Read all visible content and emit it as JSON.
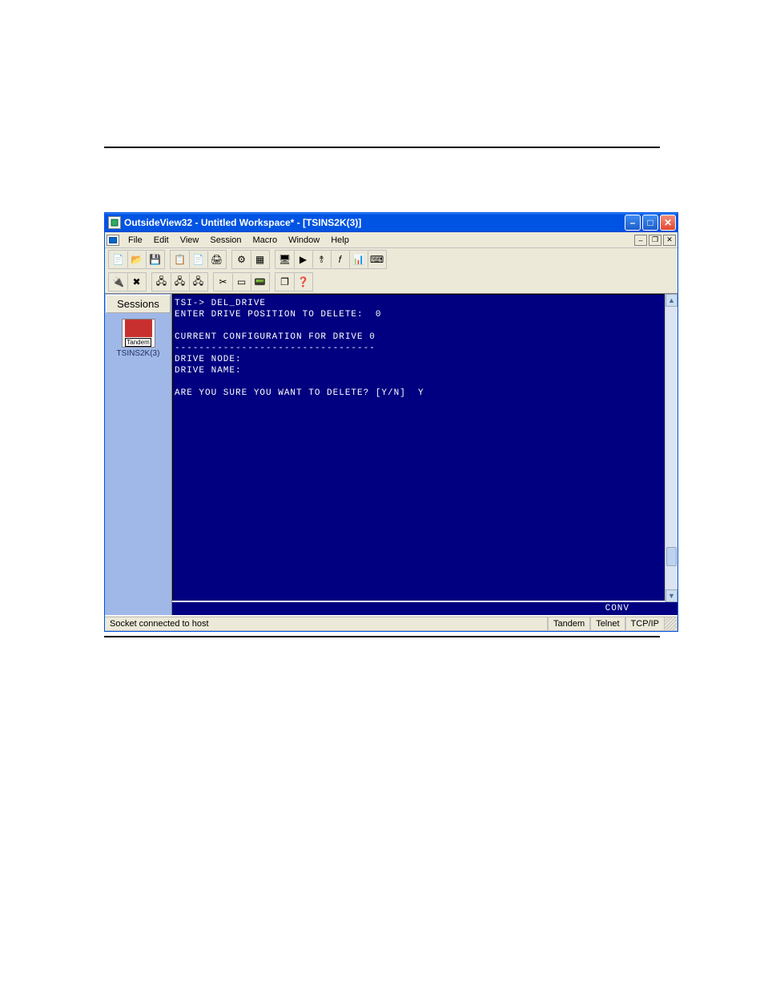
{
  "titlebar": {
    "text": "OutsideView32 - Untitled Workspace* - [TSINS2K(3)]"
  },
  "menus": [
    "File",
    "Edit",
    "View",
    "Session",
    "Macro",
    "Window",
    "Help"
  ],
  "toolbar_row1_icons": [
    [
      "new",
      "📄"
    ],
    [
      "open",
      "📂"
    ],
    [
      "save",
      "💾"
    ],
    [
      "copy",
      "📋"
    ],
    [
      "paste",
      "📄"
    ],
    [
      "print",
      "🖨"
    ],
    [
      "gear",
      "⚙"
    ],
    [
      "grid",
      "▦"
    ],
    [
      "screen",
      "🖥"
    ],
    [
      "play",
      "▶"
    ],
    [
      "binary",
      "⥉"
    ],
    [
      "fx",
      "𝑓"
    ],
    [
      "chart",
      "📊"
    ],
    [
      "keyboard",
      "⌨"
    ]
  ],
  "toolbar_row2_icons": [
    [
      "conn1",
      "🔌"
    ],
    [
      "conn2",
      "✖"
    ],
    [
      "sess1",
      "🖧"
    ],
    [
      "sess2",
      "🖧"
    ],
    [
      "sess3",
      "🖧"
    ],
    [
      "tool1",
      "✂"
    ],
    [
      "tool2",
      "▭"
    ],
    [
      "tool3",
      "📟"
    ],
    [
      "win",
      "❐"
    ],
    [
      "help",
      "❓"
    ]
  ],
  "sessions": {
    "header": "Sessions",
    "item_icon_label": "Tandem",
    "item_label": "TSINS2K(3)"
  },
  "terminal": {
    "lines": [
      "TSI-> DEL_DRIVE",
      "ENTER DRIVE POSITION TO DELETE:  0",
      "",
      "CURRENT CONFIGURATION FOR DRIVE 0",
      "---------------------------------",
      "DRIVE NODE:",
      "DRIVE NAME:",
      "",
      "ARE YOU SURE YOU WANT TO DELETE? [Y/N]  Y"
    ],
    "footer": "CONV"
  },
  "status": {
    "main": "Socket connected to host",
    "cells": [
      "Tandem",
      "Telnet",
      "TCP/IP"
    ]
  }
}
